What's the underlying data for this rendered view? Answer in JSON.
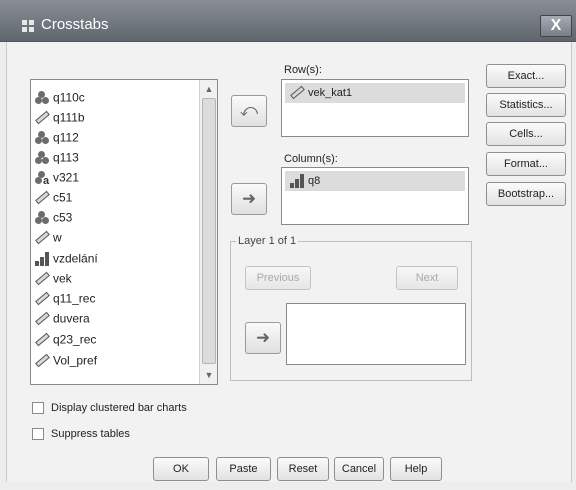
{
  "window": {
    "title": "Crosstabs",
    "close_label": "X"
  },
  "variables": [
    {
      "name": "q110c",
      "icon": "nominal-icon"
    },
    {
      "name": "q111b",
      "icon": "scale-icon"
    },
    {
      "name": "q112",
      "icon": "nominal-icon"
    },
    {
      "name": "q113",
      "icon": "nominal-icon"
    },
    {
      "name": "v321",
      "icon": "nominal-string-icon"
    },
    {
      "name": "c51",
      "icon": "scale-icon"
    },
    {
      "name": "c53",
      "icon": "nominal-icon"
    },
    {
      "name": "w",
      "icon": "scale-icon"
    },
    {
      "name": "vzdelání",
      "icon": "ordinal-icon"
    },
    {
      "name": "vek",
      "icon": "scale-icon"
    },
    {
      "name": "q11_rec",
      "icon": "scale-icon"
    },
    {
      "name": "duvera",
      "icon": "scale-icon"
    },
    {
      "name": "q23_rec",
      "icon": "scale-icon"
    },
    {
      "name": "Vol_pref",
      "icon": "scale-icon"
    }
  ],
  "rows": {
    "label": "Row(s):",
    "items": [
      "vek_kat1"
    ]
  },
  "columns": {
    "label": "Column(s):",
    "items": [
      "q8"
    ]
  },
  "layer": {
    "label": "Layer 1 of 1",
    "previous": "Previous",
    "next": "Next"
  },
  "side_buttons": [
    "Exact...",
    "Statistics...",
    "Cells...",
    "Format...",
    "Bootstrap..."
  ],
  "options": {
    "clustered_bar": "Display clustered bar charts",
    "suppress_tables": "Suppress tables"
  },
  "bottom_buttons": [
    "OK",
    "Paste",
    "Reset",
    "Cancel",
    "Help"
  ]
}
